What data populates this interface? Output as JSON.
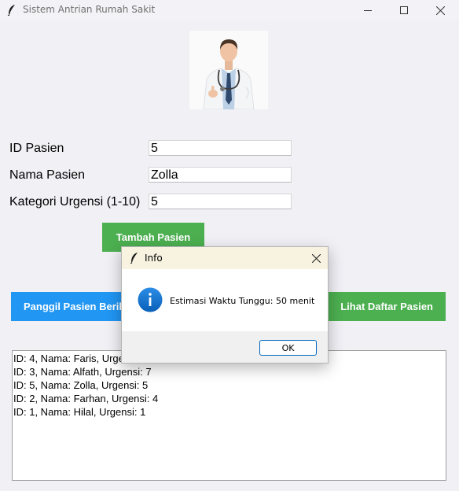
{
  "window": {
    "title": "Sistem Antrian Rumah Sakit",
    "icon": "feather-icon"
  },
  "window_controls": [
    "minimize-icon",
    "maximize-icon",
    "close-icon"
  ],
  "form": {
    "id_label": "ID Pasien",
    "id_value": "5",
    "name_label": "Nama Pasien",
    "name_value": "Zolla",
    "urgency_label": "Kategori Urgensi (1-10)",
    "urgency_value": "5"
  },
  "buttons": {
    "add": "Tambah Pasien",
    "call": "Panggil Pasien Berikutnya",
    "view": "Lihat Daftar Pasien"
  },
  "colors": {
    "green": "#4caf50",
    "blue": "#2196f3",
    "dialog_title_bg": "#f7f3e0"
  },
  "queue": [
    "ID: 4, Nama: Faris, Urgensi: 9",
    "ID: 3, Nama: Alfath, Urgensi: 7",
    "ID: 5, Nama: Zolla, Urgensi: 5",
    "ID: 2, Nama: Farhan, Urgensi: 4",
    "ID: 1, Nama: Hilal, Urgensi: 1"
  ],
  "dialog": {
    "title": "Info",
    "message": "Estimasi Waktu Tunggu: 50 menit",
    "ok": "OK",
    "icon": "info-icon"
  }
}
